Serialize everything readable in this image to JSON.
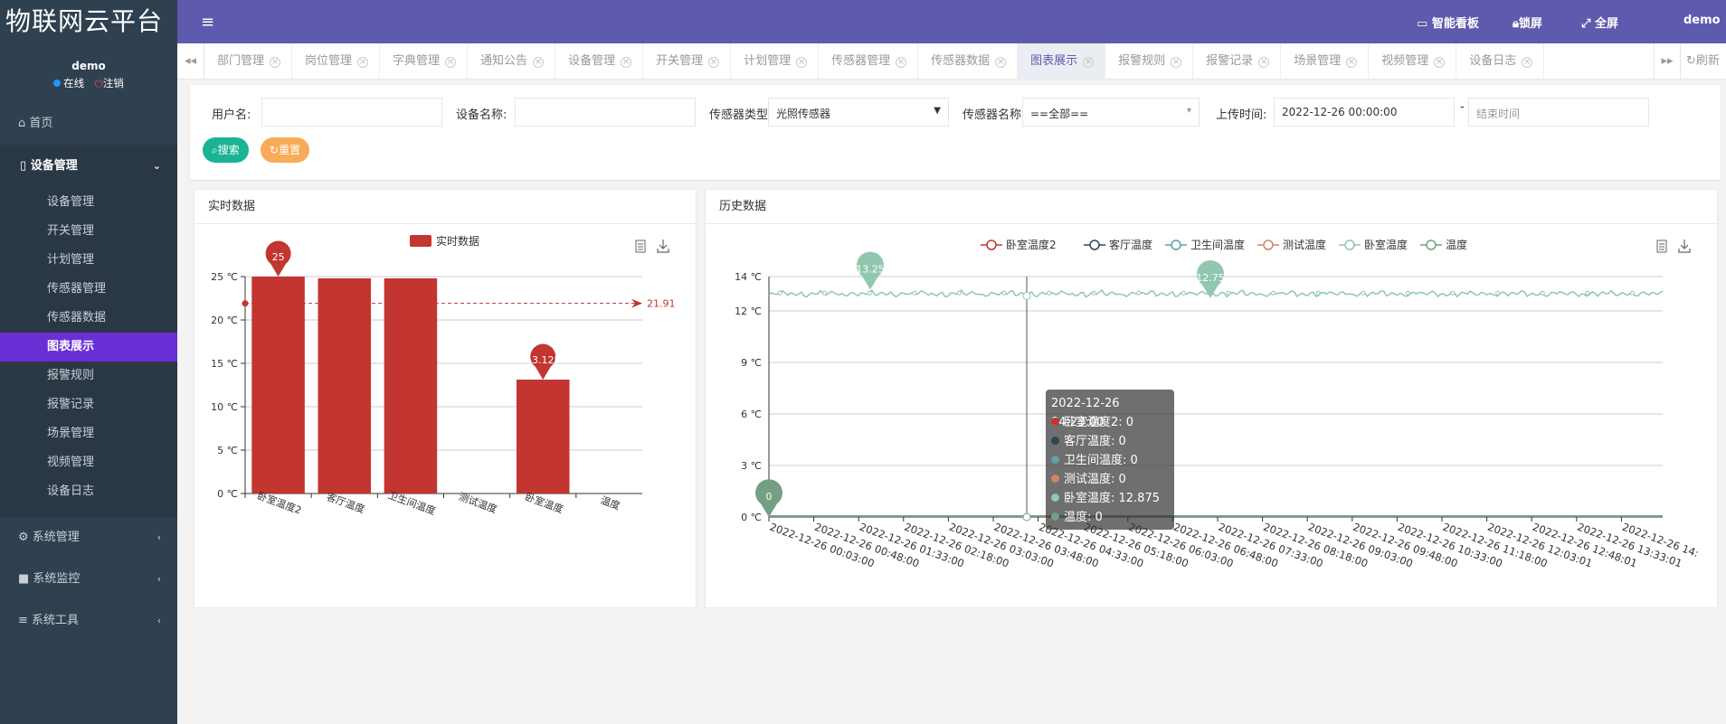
{
  "app": {
    "logo": "物联网云平台"
  },
  "user": {
    "name": "demo",
    "online": "在线",
    "logout": "注销"
  },
  "sidebar": {
    "home": "首页",
    "device_mgmt": "设备管理",
    "sub_items": [
      "设备管理",
      "开关管理",
      "计划管理",
      "传感器管理",
      "传感器数据",
      "图表展示",
      "报警规则",
      "报警记录",
      "场景管理",
      "视频管理",
      "设备日志"
    ],
    "active_index": 5,
    "system_mgmt": "系统管理",
    "system_monitor": "系统监控",
    "system_tools": "系统工具"
  },
  "topbar": {
    "dashboard": "智能看板",
    "lock": "锁屏",
    "fullscreen": "全屏",
    "user": "demo"
  },
  "tabs": {
    "items": [
      "部门管理",
      "岗位管理",
      "字典管理",
      "通知公告",
      "设备管理",
      "开关管理",
      "计划管理",
      "传感器管理",
      "传感器数据",
      "图表展示",
      "报警规则",
      "报警记录",
      "场景管理",
      "视频管理",
      "设备日志"
    ],
    "active_index": 9,
    "refresh": "刷新"
  },
  "search": {
    "username_label": "用户名:",
    "username_value": "",
    "device_name_label": "设备名称:",
    "device_name_value": "",
    "sensor_type_label": "传感器类型",
    "sensor_type_value": "光照传感器",
    "sensor_name_label": "传感器名称",
    "sensor_name_value": "==全部==",
    "upload_time_label": "上传时间:",
    "start_time": "2022-12-26 00:00:00",
    "dash": "-",
    "end_time_placeholder": "结束时间",
    "search_btn": "搜索",
    "reset_btn": "重置"
  },
  "colors": {
    "bar": "#c23531",
    "line": "#91c7ae",
    "accent": "#5e5aad",
    "search_btn": "#1ab394",
    "reset_btn": "#f8ac59"
  },
  "realtime_panel": {
    "title": "实时数据"
  },
  "history_panel": {
    "title": "历史数据"
  },
  "chart_data": [
    {
      "type": "bar",
      "legend": "实时数据",
      "categories": [
        "卧室温度2",
        "客厅温度",
        "卫生间温度",
        "测试温度",
        "卧室温度",
        "温度"
      ],
      "values": [
        25,
        24.8,
        24.8,
        0,
        13.125,
        0
      ],
      "ylim": [
        0,
        25
      ],
      "yticks": [
        0,
        5,
        10,
        15,
        20,
        25
      ],
      "yunit": "℃",
      "max_marker": {
        "label": "25",
        "category_index": 0,
        "value": 25
      },
      "min_marker": {
        "label": "13.125",
        "category_index": 4,
        "value": 13.125
      },
      "average_line": {
        "value": 21.91,
        "label": "21.91"
      },
      "grid": true
    },
    {
      "type": "line",
      "legend": [
        "卧室温度2",
        "客厅温度",
        "卫生间温度",
        "测试温度",
        "卧室温度",
        "温度"
      ],
      "legend_colors": [
        "#c23531",
        "#2f4554",
        "#61a0a8",
        "#d48265",
        "#91c7ae",
        "#749f83"
      ],
      "ylim": [
        0,
        14
      ],
      "yticks": [
        0,
        3,
        6,
        9,
        12,
        14
      ],
      "yunit": "℃",
      "xticks": [
        "2022-12-26 00:03:00",
        "2022-12-26 00:48:00",
        "2022-12-26 01:33:00",
        "2022-12-26 02:18:00",
        "2022-12-26 03:03:00",
        "2022-12-26 03:48:00",
        "2022-12-26 04:33:00",
        "2022-12-26 05:18:00",
        "2022-12-26 06:03:00",
        "2022-12-26 06:48:00",
        "2022-12-26 07:33:00",
        "2022-12-26 08:18:00",
        "2022-12-26 09:03:00",
        "2022-12-26 09:48:00",
        "2022-12-26 10:33:00",
        "2022-12-26 11:18:00",
        "2022-12-26 12:03:01",
        "2022-12-26 12:48:01",
        "2022-12-26 13:33:01",
        "2022-12-26 14:"
      ],
      "series": [
        {
          "name": "卧室温度",
          "approx_value": 13.0,
          "range": [
            12.75,
            13.25
          ]
        },
        {
          "name": "卧室温度2",
          "approx_value": 0
        },
        {
          "name": "客厅温度",
          "approx_value": 0
        },
        {
          "name": "卫生间温度",
          "approx_value": 0
        },
        {
          "name": "测试温度",
          "approx_value": 0
        },
        {
          "name": "温度",
          "approx_value": 0
        }
      ],
      "max_marker": {
        "label": "13.25"
      },
      "min_marker": {
        "label": "12.75"
      },
      "zero_marker": {
        "label": "0"
      },
      "tooltip": {
        "time": "2022-12-26 04:23:00",
        "rows": [
          {
            "name": "卧室温度2",
            "value": "0",
            "color": "#c23531"
          },
          {
            "name": "客厅温度",
            "value": "0",
            "color": "#2f4554"
          },
          {
            "name": "卫生间温度",
            "value": "0",
            "color": "#61a0a8"
          },
          {
            "name": "测试温度",
            "value": "0",
            "color": "#d48265"
          },
          {
            "name": "卧室温度",
            "value": "12.875",
            "color": "#91c7ae"
          },
          {
            "name": "温度",
            "value": "0",
            "color": "#749f83"
          }
        ]
      },
      "grid": true
    }
  ]
}
